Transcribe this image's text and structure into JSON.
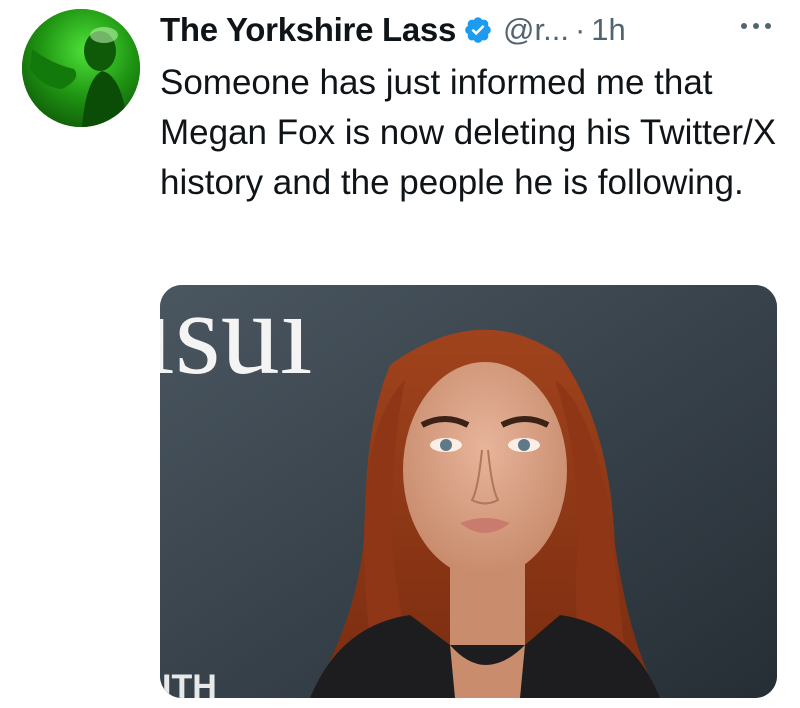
{
  "tweet": {
    "display_name": "The Yorkshire Lass",
    "handle": "@r...",
    "separator": "·",
    "time": "1h",
    "body": "Someone has just informed me that Megan Fox is now deleting his Twitter/X history and the people he is following.",
    "icons": {
      "verified": "verified-badge-icon",
      "more": "more-options-icon"
    },
    "media": {
      "backdrop_text_top": "ısuı",
      "backdrop_text_bottom": "ITH"
    }
  },
  "colors": {
    "text": "#0f1419",
    "secondary": "#536471",
    "verified_blue": "#1d9bf0",
    "avatar_green": "#2bb31a"
  }
}
